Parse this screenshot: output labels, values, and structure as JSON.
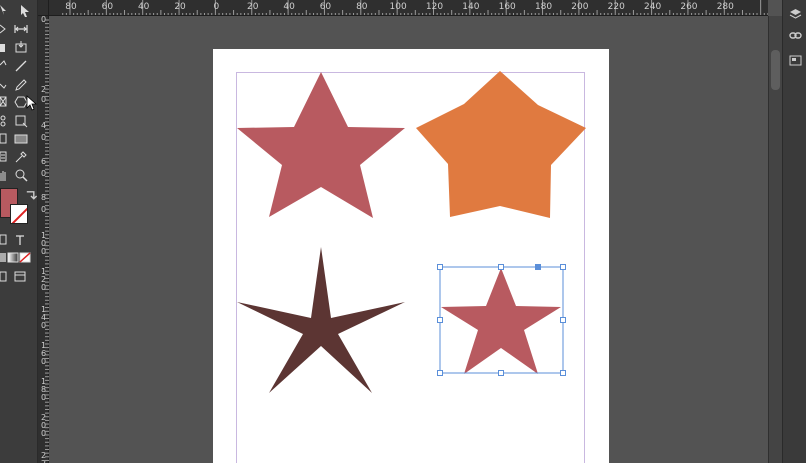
{
  "rulers": {
    "horizontal": [
      "80",
      "60",
      "40",
      "20",
      "0",
      "20",
      "40",
      "60",
      "80",
      "100",
      "120",
      "140",
      "160",
      "180",
      "200",
      "220",
      "240",
      "260",
      "280"
    ],
    "vertical": [
      "2",
      "0",
      "2",
      "0",
      "4",
      "0",
      "6",
      "0",
      "8",
      "0",
      "1 0 0",
      "1 2 0",
      "1 4 0",
      "1 6 0",
      "1 8 0",
      "2 0 0",
      "2 2"
    ]
  },
  "tools": {
    "top_to_bottom": [
      "selection-tool",
      "direct-selection-tool",
      "page-tool",
      "gap-tool",
      "type-tool",
      "line-tool",
      "pen-tool",
      "pencil-tool",
      "rectangle-frame-tool",
      "polygon-tool",
      "scissors-tool",
      "free-transform-tool",
      "rectangle-tool",
      "gradient-swatch-tool",
      "note-tool",
      "eyedropper-tool",
      "hand-tool",
      "zoom-tool"
    ]
  },
  "swatches": {
    "fill_color": "#b85a60",
    "stroke_color": "none"
  },
  "artwork": {
    "stars": [
      {
        "name": "star-1",
        "fill": "#b85a60"
      },
      {
        "name": "star-2",
        "fill": "#e07a40"
      },
      {
        "name": "star-3",
        "fill": "#5c3533"
      },
      {
        "name": "star-4",
        "fill": "#b85a60",
        "selected": true
      }
    ]
  },
  "right_panel": {
    "icons": [
      "layers-icon",
      "links-icon",
      "pages-icon"
    ]
  }
}
